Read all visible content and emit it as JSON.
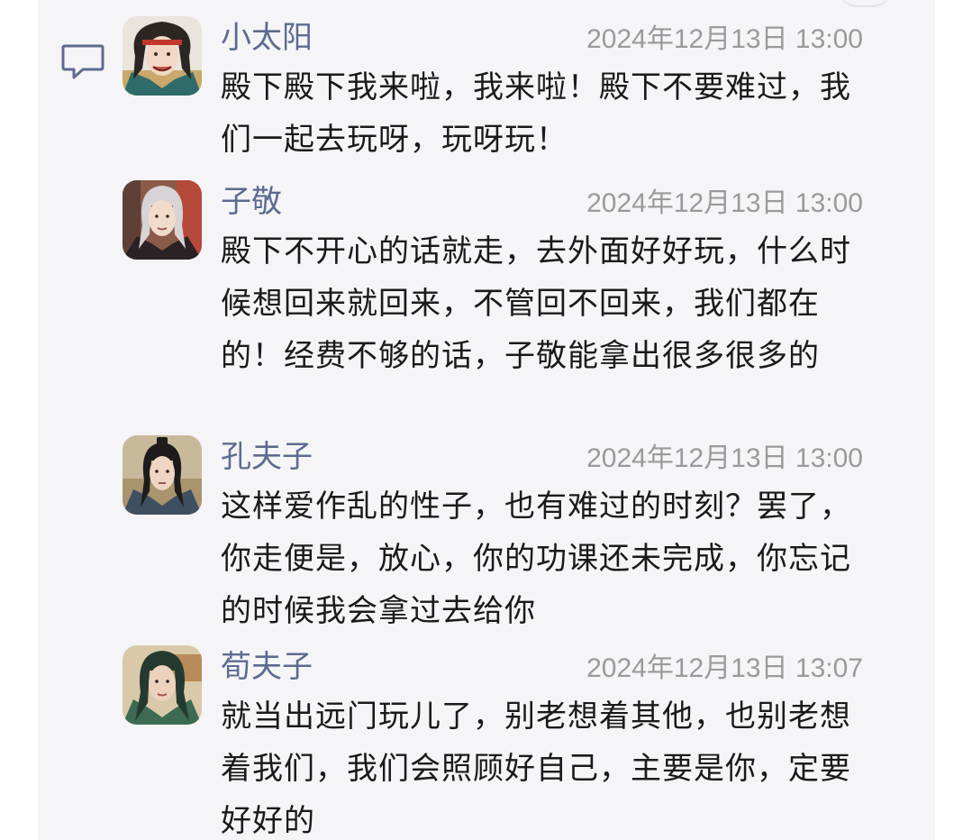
{
  "comments": [
    {
      "name": "小太阳",
      "time": "2024年12月13日 13:00",
      "text": "殿下殿下我来啦，我来啦！殿下不要难过，我们一起去玩呀，玩呀玩！",
      "avatar_icon": "avatar-xiaotaiyang-portrait"
    },
    {
      "name": "子敬",
      "time": "2024年12月13日 13:00",
      "text": "殿下不开心的话就走，去外面好好玩，什么时候想回来就回来，不管回不回来，我们都在的！经费不够的话，子敬能拿出很多很多的",
      "avatar_icon": "avatar-zijing-portrait"
    },
    {
      "name": "孔夫子",
      "time": "2024年12月13日 13:00",
      "text": "这样爱作乱的性子，也有难过的时刻？罢了，你走便是，放心，你的功课还未完成，你忘记的时候我会拿过去给你",
      "avatar_icon": "avatar-kongfuzi-portrait"
    },
    {
      "name": "荀夫子",
      "time": "2024年12月13日 13:07",
      "text": "就当出远门玩儿了，别老想着其他，也别老想着我们，我们会照顾好自己，主要是你，定要好好的",
      "avatar_icon": "avatar-xunfuzi-portrait"
    }
  ],
  "colors": {
    "name": "#5c6b8f",
    "time": "#9a9a9a",
    "text": "#1a1a1a",
    "panel_bg": "#f5f5f7",
    "icon": "#5c6b8f"
  },
  "icons": {
    "comment_icon": "comment-bubble-icon"
  }
}
